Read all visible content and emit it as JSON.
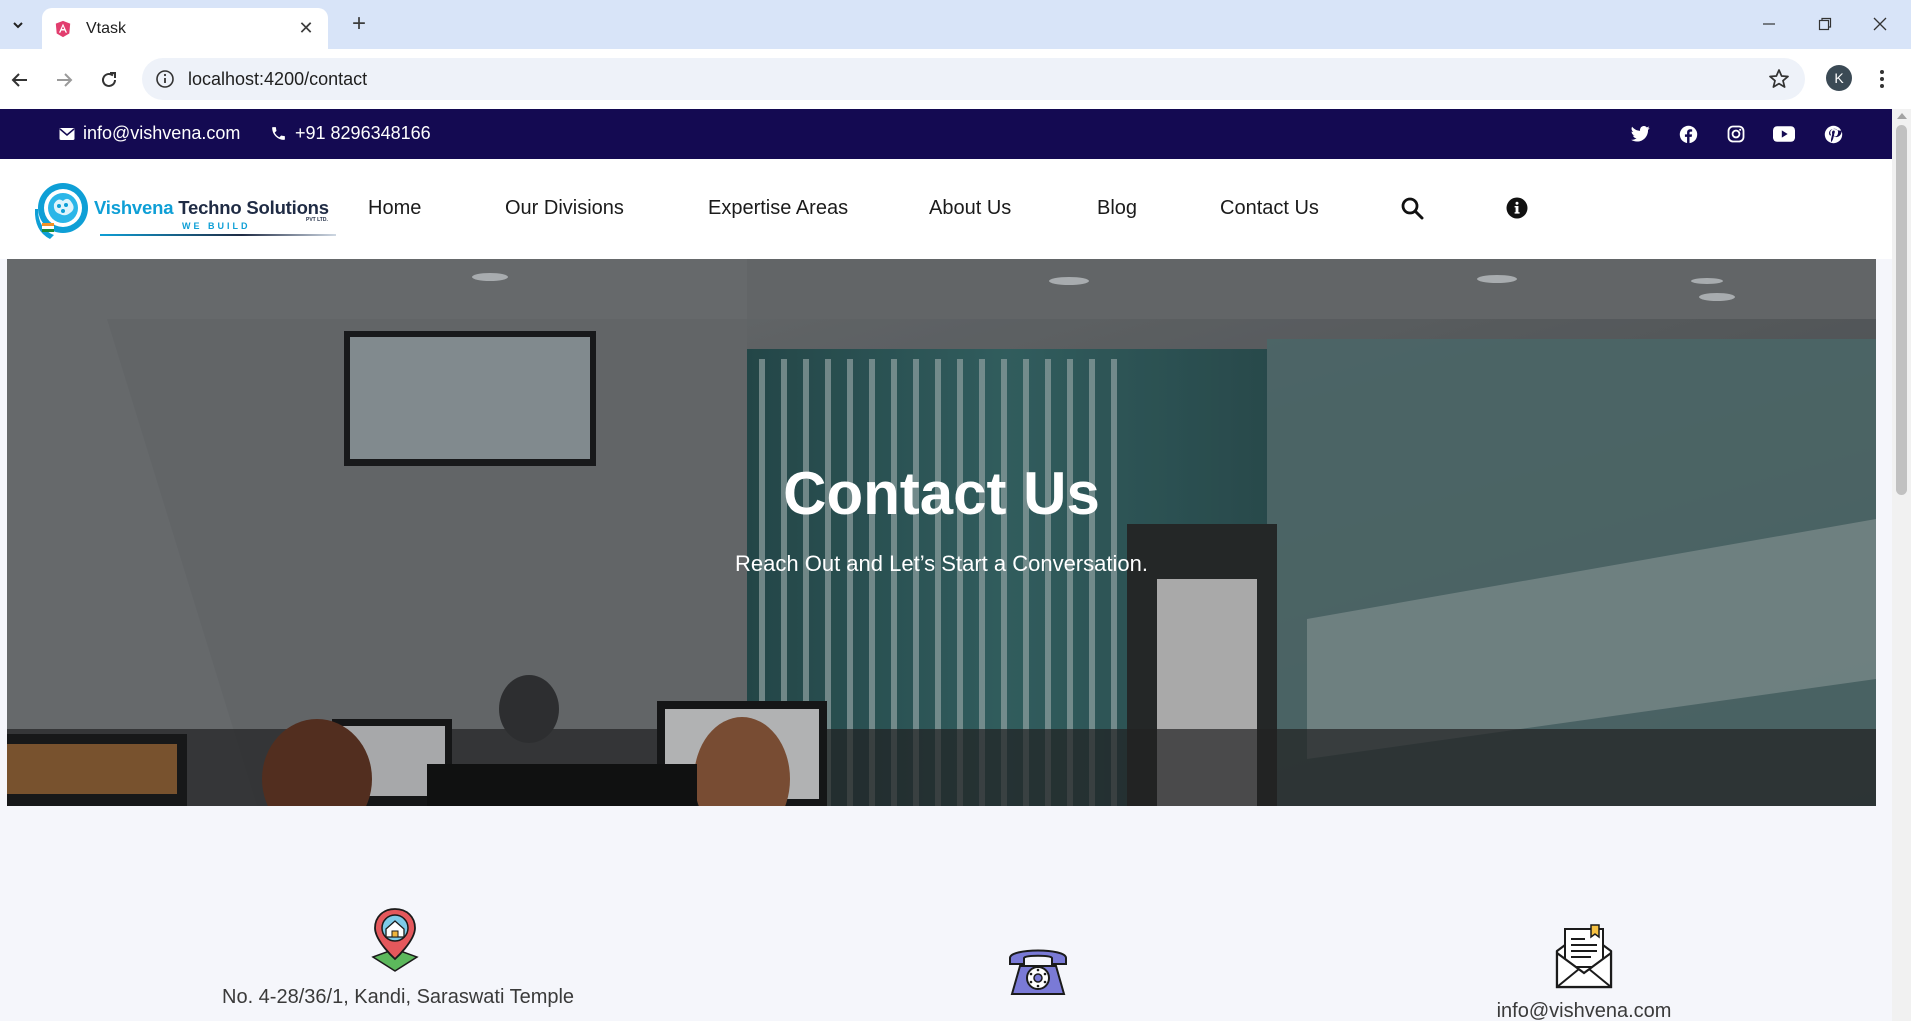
{
  "browser": {
    "tab_title": "Vtask",
    "url": "localhost:4200/contact",
    "profile_initial": "K"
  },
  "topbar": {
    "email": "info@vishvena.com",
    "phone": "+91 8296348166",
    "socials": [
      "twitter-icon",
      "facebook-icon",
      "instagram-icon",
      "youtube-icon",
      "pinterest-icon"
    ],
    "background": "#140a52"
  },
  "header": {
    "logo": {
      "name_part1": "Vishvena",
      "name_part2": " Techno Solutions",
      "tagline": "WE BUILD",
      "suffix": "PVT LTD."
    },
    "nav": [
      "Home",
      "Our Divisions",
      "Expertise Areas",
      "About Us",
      "Blog",
      "Contact Us"
    ]
  },
  "hero": {
    "title": "Contact Us",
    "subtitle": "Reach Out and Let’s Start a Conversation."
  },
  "contact_cards": {
    "address": "No. 4-28/36/1, Kandi, Saraswati Temple",
    "email": "info@vishvena.com"
  }
}
